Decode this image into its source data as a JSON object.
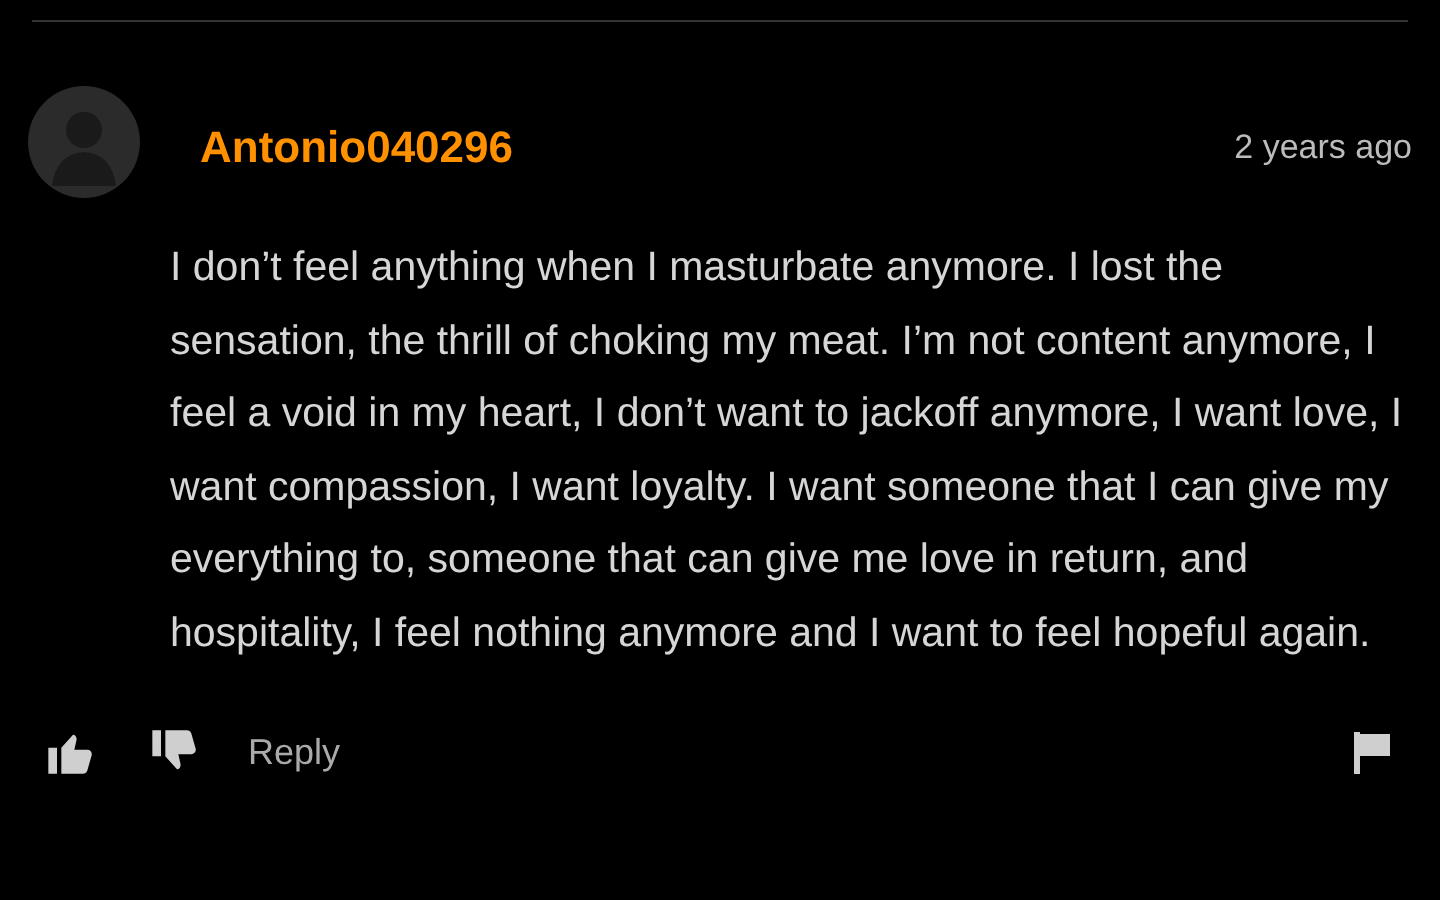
{
  "comment": {
    "username": "Antonio040296",
    "time": "2 years ago",
    "text": "I don’t feel anything when I masturbate anymore. I lost the sensation, the thrill of choking my meat. I’m not content anymore, I feel a void in my heart, I don’t want to jackoff anymore, I want love, I want compassion, I want loyalty. I want someone that I can give my everything to, someone that can give me love in return, and hospitality, I feel nothing anymore and I want to feel hopeful again.",
    "reply": "Reply"
  }
}
